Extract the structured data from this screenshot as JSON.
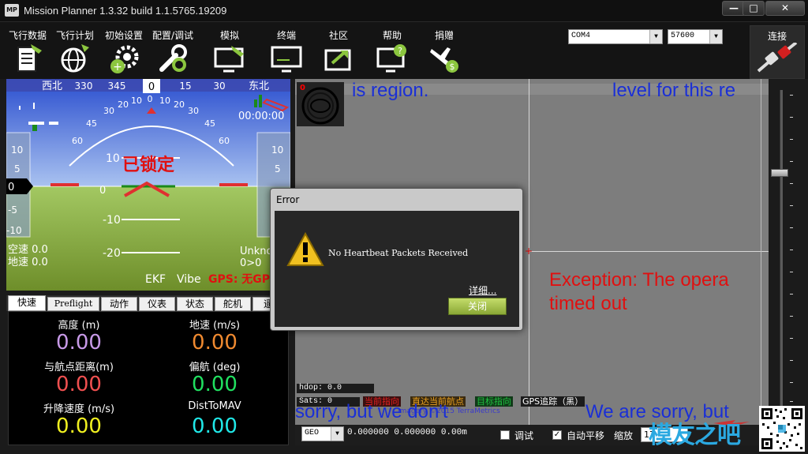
{
  "window": {
    "title": "Mission Planner 1.3.32 build 1.1.5765.19209",
    "icon_text": "MP",
    "min_glyph": "—",
    "max_glyph": "□",
    "close_glyph": "✕"
  },
  "toolbar": {
    "items": [
      {
        "label": "飞行数据",
        "icon": "flight-data-icon"
      },
      {
        "label": "飞行计划",
        "icon": "flight-plan-icon"
      },
      {
        "label": "初始设置",
        "icon": "initial-setup-icon"
      },
      {
        "label": "配置/调试",
        "icon": "config-tuning-icon"
      },
      {
        "label": "模拟",
        "icon": "simulation-icon"
      },
      {
        "label": "终端",
        "icon": "terminal-icon"
      },
      {
        "label": "社区",
        "icon": "community-icon"
      },
      {
        "label": "帮助",
        "icon": "help-icon"
      },
      {
        "label": "捐赠",
        "icon": "donate-icon"
      }
    ],
    "port": "COM4",
    "baud": "57600",
    "connect_label": "连接",
    "dropdown_glyph": "▼"
  },
  "hud": {
    "heading_labels": [
      "西北",
      "330",
      "345",
      "0",
      "15",
      "30",
      "东北"
    ],
    "pitch_labels": [
      "10",
      "0",
      "-10",
      "-20"
    ],
    "roll_labels": [
      "60",
      "45",
      "30",
      "20",
      "10",
      "0",
      "10",
      "20",
      "30",
      "45",
      "60"
    ],
    "left_tape": [
      "10",
      "5",
      "0",
      "-5",
      "-10"
    ],
    "right_tape": [
      "10",
      "5"
    ],
    "armed_status": "已锁定",
    "time": "00:00:00",
    "airspeed": "空速 0.0",
    "groundspeed": "地速 0.0",
    "unknown": "Unkno",
    "wp": "0>0",
    "ekf": "EKF",
    "vibe": "Vibe",
    "gps_status": "GPS: 无GPS"
  },
  "quick": {
    "tabs": [
      "快速",
      "Preflight",
      "动作",
      "仪表",
      "状态",
      "舵机",
      "遥"
    ],
    "cells": [
      {
        "label": "高度 (m)",
        "value": "0.00",
        "color": "#c89ae8"
      },
      {
        "label": "地速 (m/s)",
        "value": "0.00",
        "color": "#f08a30"
      },
      {
        "label": "与航点距离(m)",
        "value": "0.00",
        "color": "#f05050"
      },
      {
        "label": "偏航 (deg)",
        "value": "0.00",
        "color": "#20e060"
      },
      {
        "label": "升降速度 (m/s)",
        "value": "0.00",
        "color": "#f0f020"
      },
      {
        "label": "DistToMAV",
        "value": "0.00",
        "color": "#20e8e8"
      }
    ]
  },
  "map": {
    "text_top_left": "is region.",
    "text_top_right": "level for this re",
    "exception_line1": "Exception: The opera",
    "exception_line2": "timed out",
    "sorry_left": "sorry, but we don't",
    "sorry_right": "We are sorry, but",
    "compass_zero": "0",
    "hdop": "hdop: 0.0",
    "sats": "Sats: 0",
    "legend": [
      {
        "label": "当前指向",
        "color": "#e02020"
      },
      {
        "label": "直达当前航点",
        "color": "#e8a020"
      },
      {
        "label": "目标指向",
        "color": "#20c040"
      },
      {
        "label": "GPS追踪（黑）",
        "color": "#ffffff"
      }
    ],
    "copyright": "Imagery ©2015 TerraMetrics"
  },
  "bottom": {
    "geo": "GEO",
    "coords": "0.000000 0.000000   0.00m",
    "debug_label": "调试",
    "autopan_label": "自动平移",
    "autopan_check": "✓",
    "zoom_label": "缩放",
    "zoom_value": "17"
  },
  "dialog": {
    "title": "Error",
    "message": "No Heartbeat Packets Received",
    "details": "详细...",
    "close": "关闭"
  },
  "watermark": {
    "text": "模友之吧"
  }
}
